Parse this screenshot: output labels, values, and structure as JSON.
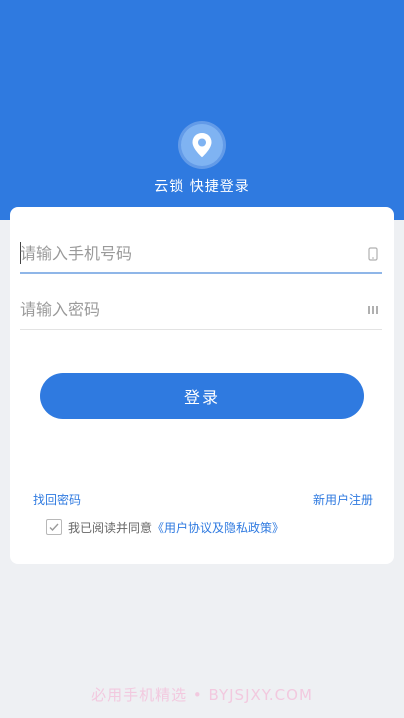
{
  "header": {
    "title": "云锁 快捷登录",
    "logo_icon": "location-pin-icon"
  },
  "form": {
    "phone_placeholder": "请输入手机号码",
    "phone_icon": "phone-icon",
    "password_placeholder": "请输入密码",
    "password_icon": "keypad-icon",
    "login_label": "登录"
  },
  "links": {
    "forgot_password": "找回密码",
    "register": "新用户注册"
  },
  "agreement": {
    "checked": true,
    "prefix": "我已阅读并同意",
    "link": "《用户协议及隐私政策》"
  },
  "watermark": "必用手机精选 • BYJSJXY.COM",
  "colors": {
    "brand": "#2f7ae0",
    "background": "#eef0f3",
    "card": "#ffffff"
  }
}
